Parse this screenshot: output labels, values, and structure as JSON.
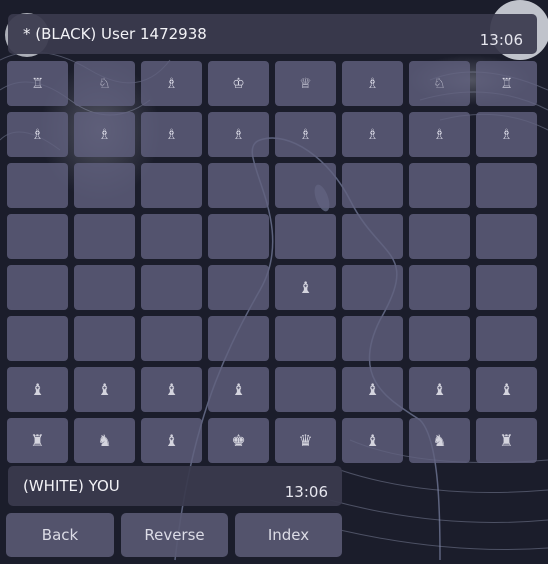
{
  "opponent": {
    "label": "* (BLACK) User 1472938",
    "clock": "13:06"
  },
  "player": {
    "label": "(WHITE) YOU",
    "clock": "13:06"
  },
  "board": {
    "ranks": [
      [
        "♖",
        "♘",
        "♗",
        "♔",
        "♕",
        "♗",
        "♘",
        "♖"
      ],
      [
        "♗",
        "♗",
        "♗",
        "♗",
        "♗",
        "♗",
        "♗",
        "♗"
      ],
      [
        "",
        "",
        "",
        "",
        "",
        "",
        "",
        ""
      ],
      [
        "",
        "",
        "",
        "",
        "",
        "",
        "",
        ""
      ],
      [
        "",
        "",
        "",
        "",
        "♝",
        "",
        "",
        ""
      ],
      [
        "",
        "",
        "",
        "",
        "",
        "",
        "",
        ""
      ],
      [
        "♝",
        "♝",
        "♝",
        "♝",
        "",
        "♝",
        "♝",
        "♝"
      ],
      [
        "♜",
        "♞",
        "♝",
        "♚",
        "♛",
        "♝",
        "♞",
        "♜"
      ]
    ],
    "square_color": "#62628a",
    "piece_color_black_side": "#d8d8e4",
    "piece_color_white_side": "#d4d4de"
  },
  "buttons": {
    "back": "Back",
    "reverse": "Reverse",
    "index": "Index"
  },
  "colors": {
    "background": "#1b1d2b",
    "bar": "#3a3a4e",
    "button": "#585872"
  }
}
